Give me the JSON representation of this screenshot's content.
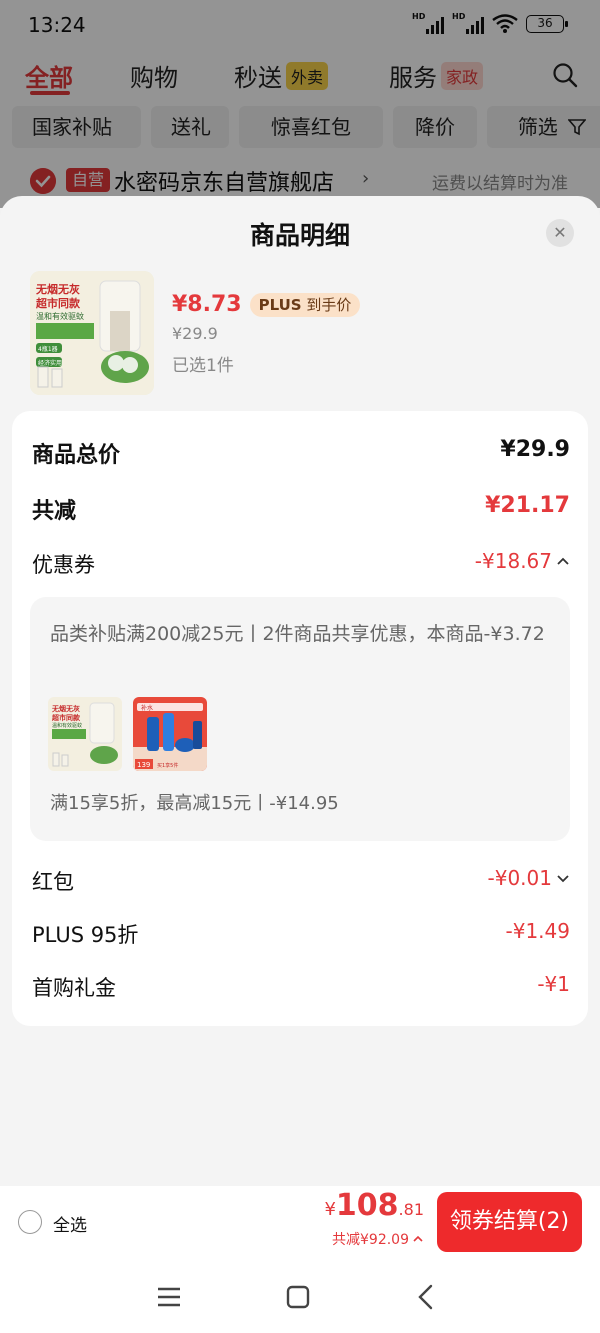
{
  "status_bar": {
    "time": "13:24",
    "signal_labels": [
      "HD",
      "HD"
    ],
    "battery": "36"
  },
  "background_page": {
    "tabs": [
      {
        "label": "全部",
        "active": true
      },
      {
        "label": "购物",
        "active": false
      },
      {
        "label": "秒送",
        "tag": "外卖",
        "active": false
      },
      {
        "label": "服务",
        "tag": "家政",
        "active": false
      }
    ],
    "filters": [
      "国家补贴",
      "送礼",
      "惊喜红包",
      "降价",
      "筛选"
    ],
    "shop": {
      "self_tag": "自营",
      "name": "水密码京东自营旗舰店",
      "shipping_note": "运费以结算时为准"
    }
  },
  "sheet": {
    "title": "商品明细",
    "product": {
      "price": "¥8.73",
      "plus_tag_brand": "PLUS",
      "plus_tag_text": "到手价",
      "original_price": "¥29.9",
      "selected": "已选1件",
      "image_text": [
        "无烟无灰",
        "超市同款",
        "温和有效驱蚊",
        "4瓶1器",
        "经济实用"
      ]
    },
    "details": {
      "total_label": "商品总价",
      "total_value": "¥29.9",
      "reduce_label": "共减",
      "reduce_value": "¥21.17",
      "coupon_label": "优惠券",
      "coupon_value": "-¥18.67",
      "coupon_desc": "品类补贴满200减25元丨2件商品共享优惠，本商品-¥3.72",
      "coupon_line2": "满15享5折，最高减15元丨-¥14.95",
      "thumb2_text": [
        "补水",
        "139",
        "买1享5件"
      ],
      "redpacket_label": "红包",
      "redpacket_value": "-¥0.01",
      "plus_label": "PLUS 95折",
      "plus_value": "-¥1.49",
      "gift_label": "首购礼金",
      "gift_value": "-¥1"
    }
  },
  "action_bar": {
    "select_all": "全选",
    "currency": "¥",
    "price_int": "108",
    "price_dec": ".81",
    "discount": "共减¥92.09",
    "checkout": "领券结算(2)"
  },
  "colors": {
    "accent_red": "#e4393c",
    "checkout_red": "#ee2a2c",
    "plus_gold": "#fbe1c8"
  }
}
